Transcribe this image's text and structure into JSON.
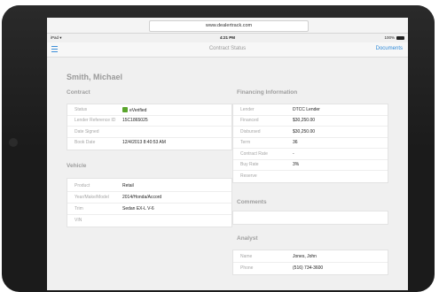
{
  "browser": {
    "url": "www.dealertrack.com"
  },
  "statusbar": {
    "carrier": "iPad ▾",
    "time": "4:21 PM",
    "battery": "100%"
  },
  "navbar": {
    "title": "Contract Status",
    "documents_label": "Documents"
  },
  "customer_name": "Smith, Michael",
  "contract": {
    "title": "Contract",
    "rows": [
      {
        "label": "Status",
        "value": "eVerified"
      },
      {
        "label": "Lender Reference ID",
        "value": "15C1865025"
      },
      {
        "label": "Date Signed",
        "value": ""
      },
      {
        "label": "Book Date",
        "value": "12/4/2013 8:40:53 AM"
      }
    ]
  },
  "vehicle": {
    "title": "Vehicle",
    "rows": [
      {
        "label": "Product",
        "value": "Retail"
      },
      {
        "label": "Year/Make/Model",
        "value": "2014/Honda/Accord"
      },
      {
        "label": "Trim",
        "value": "Sedan EX-L V-6"
      },
      {
        "label": "VIN",
        "value": ""
      }
    ]
  },
  "financing": {
    "title": "Financing Information",
    "rows": [
      {
        "label": "Lender",
        "value": "DTCC Lender"
      },
      {
        "label": "Financed",
        "value": "$30,250.00"
      },
      {
        "label": "Disbursed",
        "value": "$30,250.00"
      },
      {
        "label": "Term",
        "value": "36"
      },
      {
        "label": "Contract Rate",
        "value": "-"
      },
      {
        "label": "Buy Rate",
        "value": "3%"
      },
      {
        "label": "Reserve",
        "value": ""
      }
    ]
  },
  "comments": {
    "title": "Comments"
  },
  "analyst": {
    "title": "Analyst",
    "rows": [
      {
        "label": "Name",
        "value": "Jones, John"
      },
      {
        "label": "Phone",
        "value": "(516) 734-3600"
      }
    ]
  },
  "colors": {
    "accent": "#2f8ad8",
    "verified": "#5aa52c",
    "label": "#a6a6a6"
  }
}
